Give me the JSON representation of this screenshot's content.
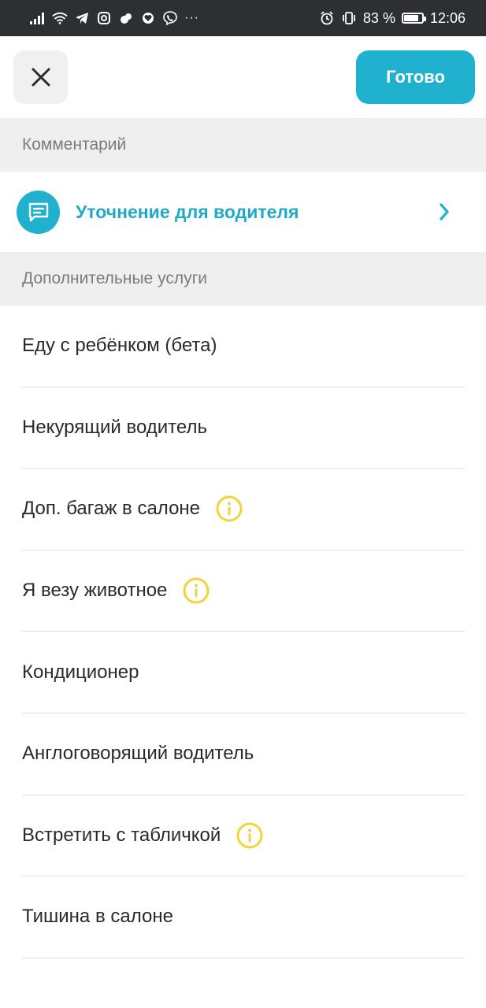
{
  "status_bar": {
    "battery_percent_label": "83 %",
    "battery_level": 0.83,
    "time": "12:06",
    "left_icons": [
      "signal-icon",
      "wifi-icon",
      "telegram-icon",
      "instagram-icon",
      "app-icon",
      "heart-icon",
      "viber-icon"
    ],
    "more_label": "···"
  },
  "top_bar": {
    "close_icon": "close-icon",
    "done_label": "Готово"
  },
  "sections": {
    "comment_header": "Комментарий",
    "extra_header": "Дополнительные услуги"
  },
  "comment": {
    "label": "Уточнение для водителя",
    "icon": "comment-icon"
  },
  "options": [
    {
      "label": "Еду с ребёнком (бета)",
      "info": false
    },
    {
      "label": "Некурящий водитель",
      "info": false
    },
    {
      "label": "Доп. багаж в салоне",
      "info": true
    },
    {
      "label": "Я везу животное",
      "info": true
    },
    {
      "label": "Кондиционер",
      "info": false
    },
    {
      "label": "Англоговорящий водитель",
      "info": false
    },
    {
      "label": "Встретить с табличкой",
      "info": true
    },
    {
      "label": "Тишина в салоне",
      "info": false
    }
  ],
  "colors": {
    "accent": "#20b1cf",
    "info_icon": "#f2d33a",
    "status_bar_bg": "#2d2f32",
    "section_bg": "#efefef"
  }
}
